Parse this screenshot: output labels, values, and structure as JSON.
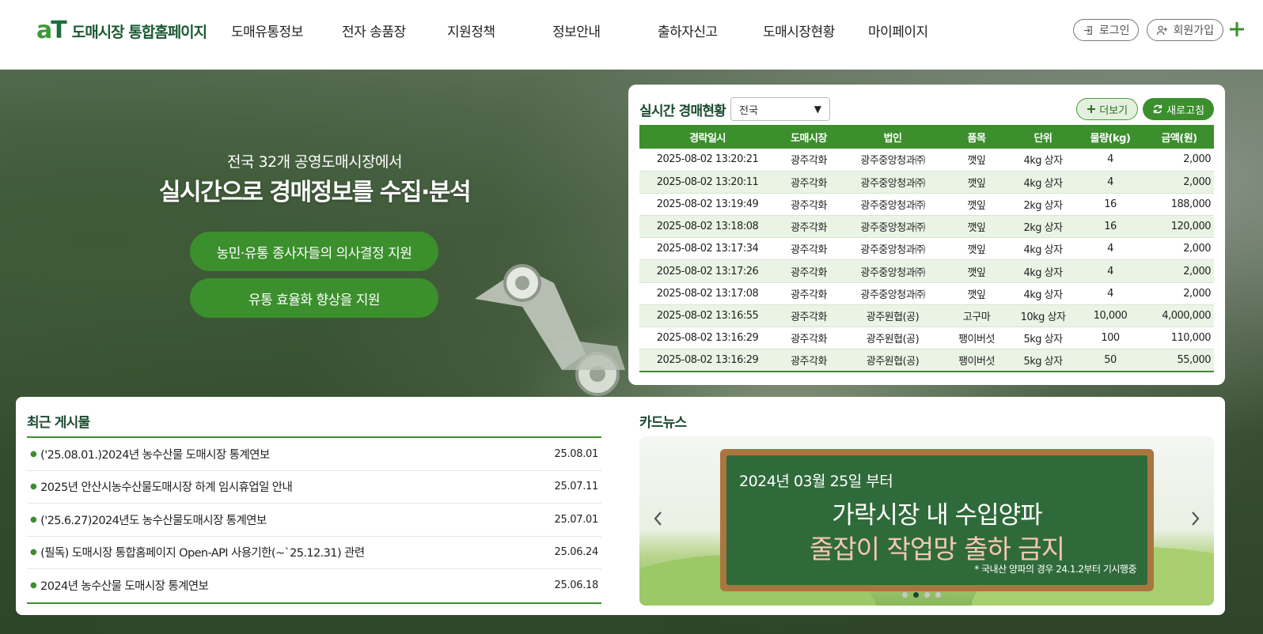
{
  "header": {
    "logo_mark_a": "a",
    "logo_mark_t": "T",
    "logo_text": "도매시장 통합홈페이지",
    "nav": [
      "도매유통정보",
      "전자 송품장",
      "지원정책",
      "정보안내",
      "출하자신고",
      "도매시장현황",
      "마이페이지"
    ],
    "login_label": "로그인",
    "signup_label": "회원가입",
    "accent_color": "#3b8f2c"
  },
  "hero": {
    "subtitle": "전국 32개 공영도매시장에서",
    "title": "실시간으로 경매정보를 수집·분석",
    "buttons": [
      "농민·유통 종사자들의 의사결정 지원",
      "유통 효율화 향상을 지원"
    ]
  },
  "auction": {
    "title": "실시간 경매현황",
    "region_selected": "전국",
    "more_label": "더보기",
    "refresh_label": "새로고침",
    "columns": [
      "경락일시",
      "도매시장",
      "법인",
      "품목",
      "단위",
      "물량(kg)",
      "금액(원)"
    ],
    "rows": [
      [
        "2025-08-02 13:20:21",
        "광주각화",
        "광주중앙청과㈜",
        "깻잎",
        "4kg 상자",
        "4",
        "2,000"
      ],
      [
        "2025-08-02 13:20:11",
        "광주각화",
        "광주중앙청과㈜",
        "깻잎",
        "4kg 상자",
        "4",
        "2,000"
      ],
      [
        "2025-08-02 13:19:49",
        "광주각화",
        "광주중앙청과㈜",
        "깻잎",
        "2kg 상자",
        "16",
        "188,000"
      ],
      [
        "2025-08-02 13:18:08",
        "광주각화",
        "광주중앙청과㈜",
        "깻잎",
        "2kg 상자",
        "16",
        "120,000"
      ],
      [
        "2025-08-02 13:17:34",
        "광주각화",
        "광주중앙청과㈜",
        "깻잎",
        "4kg 상자",
        "4",
        "2,000"
      ],
      [
        "2025-08-02 13:17:26",
        "광주각화",
        "광주중앙청과㈜",
        "깻잎",
        "4kg 상자",
        "4",
        "2,000"
      ],
      [
        "2025-08-02 13:17:08",
        "광주각화",
        "광주중앙청과㈜",
        "깻잎",
        "4kg 상자",
        "4",
        "2,000"
      ],
      [
        "2025-08-02 13:16:55",
        "광주각화",
        "광주원협(공)",
        "고구마",
        "10kg 상자",
        "10,000",
        "4,000,000"
      ],
      [
        "2025-08-02 13:16:29",
        "광주각화",
        "광주원협(공)",
        "팽이버섯",
        "5kg 상자",
        "100",
        "110,000"
      ],
      [
        "2025-08-02 13:16:29",
        "광주각화",
        "광주원협(공)",
        "팽이버섯",
        "5kg 상자",
        "50",
        "55,000"
      ]
    ]
  },
  "posts": {
    "title": "최근 게시물",
    "items": [
      {
        "title": "('25.08.01.)2024년 농수산물 도매시장 통계연보",
        "date": "25.08.01"
      },
      {
        "title": "2025년 안산시농수산물도매시장 하계 임시휴업일 안내",
        "date": "25.07.11"
      },
      {
        "title": "('25.6.27)2024년도 농수산물도매시장 통계연보",
        "date": "25.07.01"
      },
      {
        "title": "(필독) 도매시장 통합홈페이지 Open-API 사용기한(~`25.12.31) 관련",
        "date": "25.06.24"
      },
      {
        "title": "2024년 농수산물 도매시장 통계연보",
        "date": "25.06.18"
      }
    ]
  },
  "cardnews": {
    "title": "카드뉴스",
    "board_date": "2024년 03월 25일 부터",
    "board_line1": "가락시장 내 수입양파",
    "board_line2": "줄잡이 작업망 출하 금지",
    "board_note": "* 국내산 양파의 경우 24.1.2부터 기시행중",
    "active_slide": 2,
    "slide_count": 4
  }
}
